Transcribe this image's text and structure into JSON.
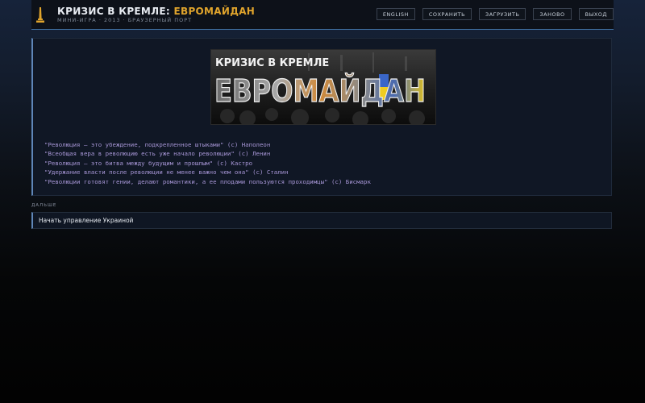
{
  "header": {
    "title_main": "КРИЗИС В КРЕМЛЕ: ",
    "title_accent": "ЕВРОМАЙДАН",
    "subtitle": "МИНИ-ИГРА · 2013 · БРАУЗЕРНЫЙ ПОРТ",
    "logo_icon": "obelisk-icon",
    "nav": [
      {
        "label": "ENGLISH"
      },
      {
        "label": "СОХРАНИТЬ"
      },
      {
        "label": "ЗАГРУЗИТЬ"
      },
      {
        "label": "ЗАНОВО"
      },
      {
        "label": "ВЫХОД"
      }
    ]
  },
  "banner": {
    "line1": "КРИЗИС В КРЕМЛЕ",
    "line2": "ЕВРОМАЙДАН"
  },
  "quotes": [
    "\"Революция — это убеждение, подкрепленное штыками\" (с) Наполеон",
    "\"Всеобщая вера в революцию есть уже начало революции\" (с) Ленин",
    "\"Революция — это битва между будущим и прошлым\" (с) Кастро",
    "\"Удержание власти после революции не менее важно чем она\" (с) Сталин",
    "\"Революции готовят гении, делают романтики, а ее плодами пользуются проходимцы\" (с) Бисмарк"
  ],
  "next": {
    "label": "ДАЛЬШЕ",
    "choices": [
      {
        "label": "Начать управление Украиной"
      }
    ]
  },
  "colors": {
    "accent": "#e0a42c",
    "quote_text": "#a796d6",
    "border_accent": "#5f86b8"
  }
}
